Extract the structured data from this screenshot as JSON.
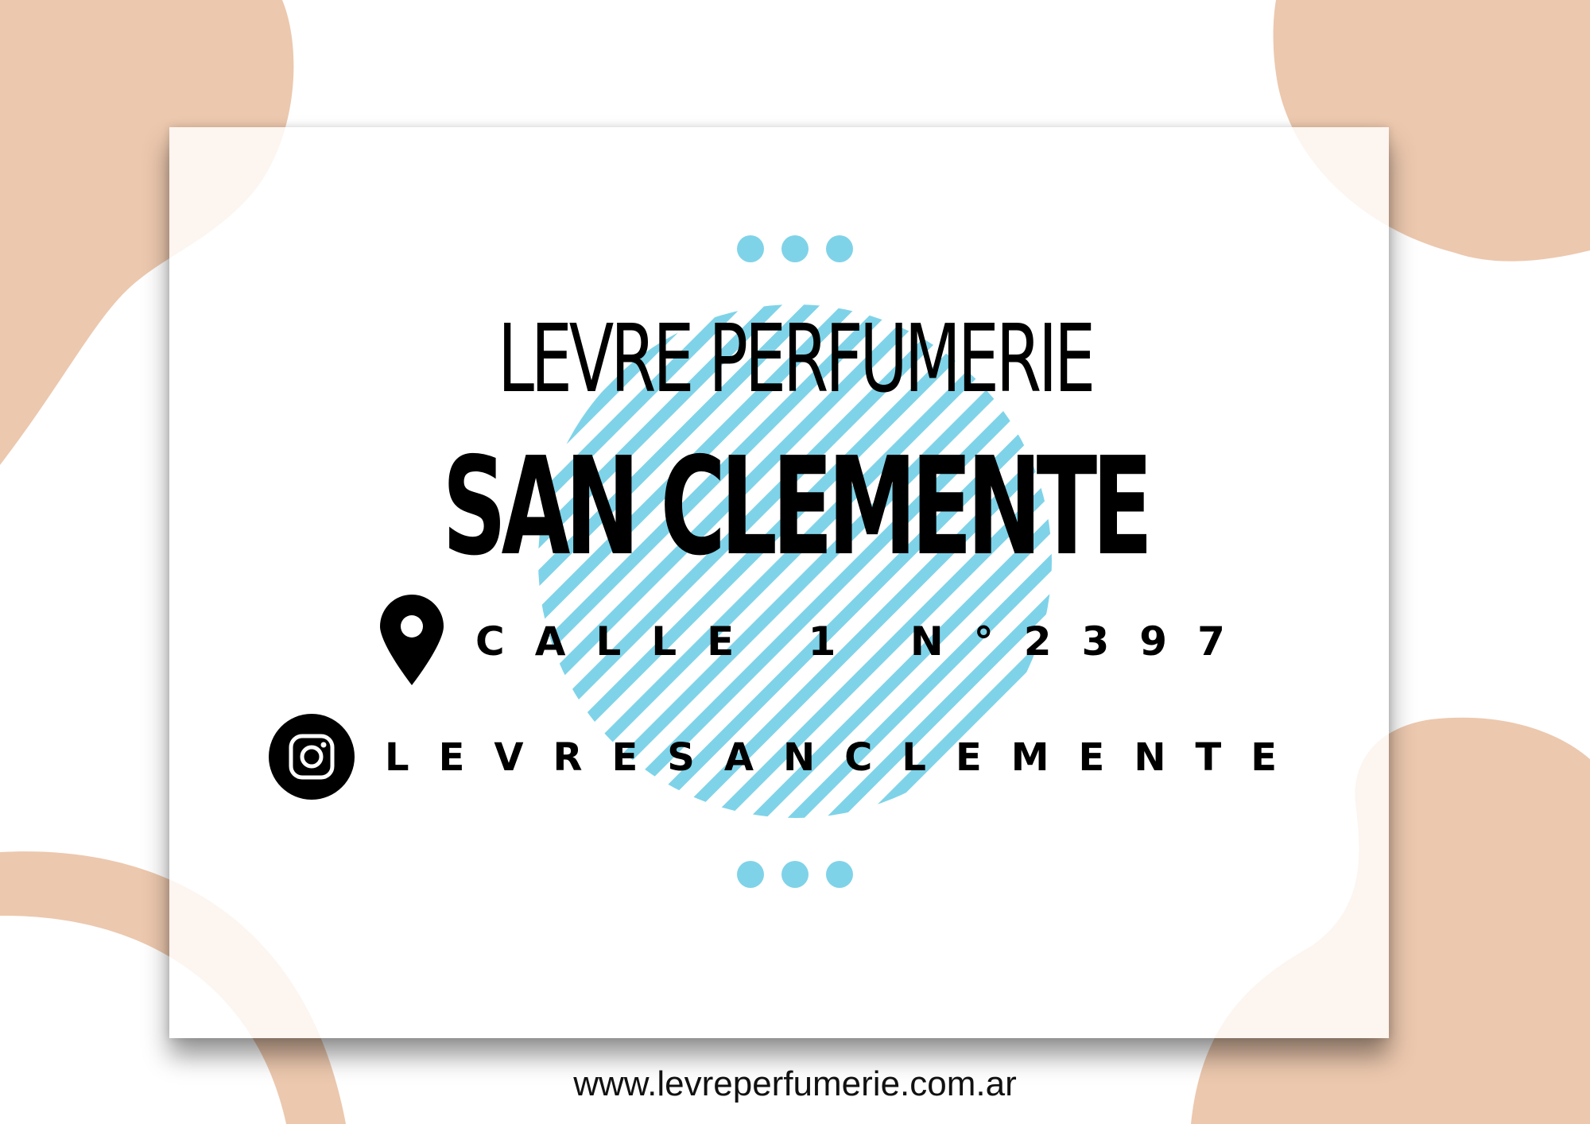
{
  "card": {
    "store_name": "LEVRE PERFUMERIE",
    "branch_name": "SAN CLEMENTE",
    "address": "CALLE 1 N°2397",
    "instagram_handle": "LEVRESANCLEMENTE"
  },
  "footer": {
    "website": "www.levreperfumerie.com.ar"
  },
  "icons": {
    "address": "map-pin-icon",
    "instagram": "instagram-icon"
  },
  "colors": {
    "background": "#ffffff",
    "blob": "#ecc8ae",
    "accent_blue": "#7fd3e8",
    "text": "#000000"
  }
}
